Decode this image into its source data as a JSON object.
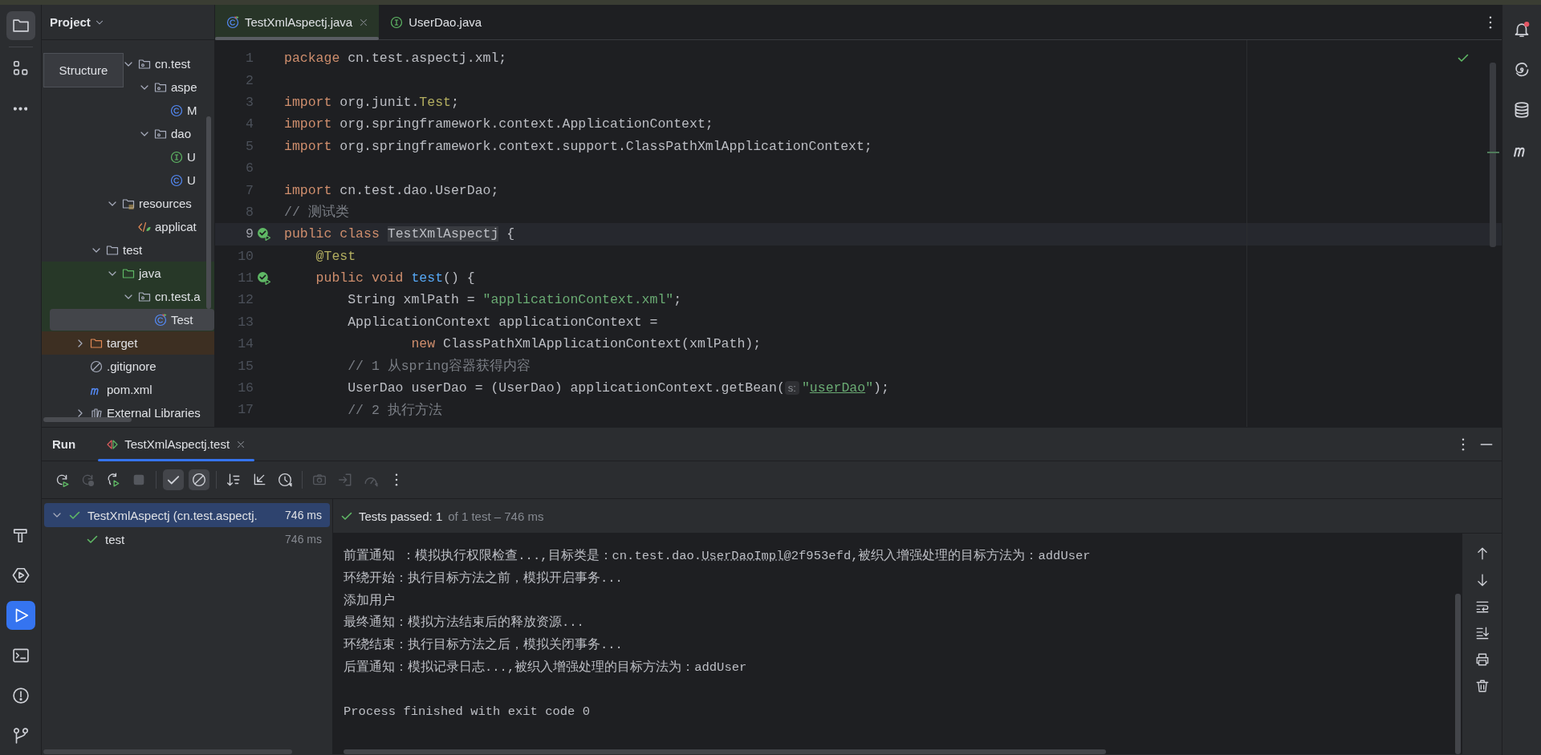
{
  "tool_strip": {
    "top": [
      {
        "selected": true
      },
      {
        "selected": false
      }
    ],
    "bottom": [
      {
        "selected": false
      },
      {
        "selected": false
      },
      {
        "selected": true
      },
      {
        "selected": false
      },
      {
        "selected": false
      },
      {
        "selected": false
      }
    ]
  },
  "project_panel": {
    "title": "Project",
    "tooltip": "Structure",
    "tree": [
      {
        "continued": true,
        "children": [
          {
            "continued": true,
            "children": [
              {
                "continued": true,
                "children": [
                  {
                    "label": "cn.test",
                    "kind": "package",
                    "expanded": true,
                    "selected": false,
                    "children": [
                      {
                        "label": "aspe",
                        "kind": "package",
                        "expanded": true,
                        "selected": false,
                        "children": [
                          {
                            "label": "M",
                            "kind": "class",
                            "selected": false
                          }
                        ]
                      },
                      {
                        "label": "dao",
                        "kind": "package",
                        "expanded": true,
                        "selected": false,
                        "children": [
                          {
                            "label": "U",
                            "kind": "interface",
                            "selected": false
                          },
                          {
                            "label": "U",
                            "kind": "class",
                            "selected": false
                          }
                        ]
                      }
                    ]
                  }
                ]
              },
              {
                "label": "resources",
                "kind": "resources",
                "expanded": true,
                "selected": false,
                "children": [
                  {
                    "label": "applicat",
                    "kind": "xml",
                    "selected": false
                  }
                ]
              }
            ]
          },
          {
            "label": "test",
            "kind": "folder",
            "expanded": true,
            "selected": false,
            "children": [
              {
                "label": "java",
                "kind": "test-root",
                "expanded": true,
                "selected": false,
                "children": [
                  {
                    "label": "cn.test.a",
                    "kind": "package",
                    "expanded": true,
                    "selected": false,
                    "children": [
                      {
                        "label": "Test",
                        "kind": "test-class",
                        "selected": true
                      }
                    ]
                  }
                ]
              }
            ]
          }
        ]
      },
      {
        "label": "target",
        "kind": "excluded",
        "expanded": false,
        "selected": false
      },
      {
        "label": ".gitignore",
        "kind": "ignore",
        "selected": false
      },
      {
        "label": "pom.xml",
        "kind": "maven",
        "selected": false
      },
      {
        "label": "External Libraries",
        "kind": "library",
        "expanded": false,
        "selected": false
      }
    ]
  },
  "editor": {
    "tabs": [
      {
        "label": "TestXmlAspectj.java",
        "kind": "test-class",
        "selected": true
      },
      {
        "label": "UserDao.java",
        "kind": "interface",
        "selected": false
      }
    ],
    "no_problems": true,
    "lines": [
      {
        "number": "1",
        "tokens": [
          {
            "kind": "keyword",
            "text": "package"
          },
          {
            "kind": "plain",
            "text": " cn.test.aspectj.xml;"
          }
        ]
      },
      {
        "number": "2"
      },
      {
        "number": "3",
        "tokens": [
          {
            "kind": "keyword",
            "text": "import"
          },
          {
            "kind": "plain",
            "text": " org.junit."
          },
          {
            "kind": "annotation",
            "text": "Test"
          },
          {
            "kind": "plain",
            "text": ";"
          }
        ]
      },
      {
        "number": "4",
        "tokens": [
          {
            "kind": "keyword",
            "text": "import"
          },
          {
            "kind": "plain",
            "text": " org.springframework.context.ApplicationContext;"
          }
        ]
      },
      {
        "number": "5",
        "tokens": [
          {
            "kind": "keyword",
            "text": "import"
          },
          {
            "kind": "plain",
            "text": " org.springframework.context.support.ClassPathXmlApplicationContext;"
          }
        ]
      },
      {
        "number": "6"
      },
      {
        "number": "7",
        "tokens": [
          {
            "kind": "keyword",
            "text": "import"
          },
          {
            "kind": "plain",
            "text": " cn.test.dao.UserDao;"
          }
        ]
      },
      {
        "number": "8",
        "tokens": [
          {
            "kind": "comment",
            "text": "// 测试类"
          }
        ]
      },
      {
        "number": "9",
        "current": true,
        "run_marker": true,
        "tokens": [
          {
            "kind": "keyword",
            "text": "public class "
          },
          {
            "kind": "highlight",
            "text": "TestXmlAspectj"
          },
          {
            "kind": "plain",
            "text": " {"
          }
        ]
      },
      {
        "number": "10",
        "tokens": [
          {
            "kind": "annotation",
            "text": "    @Test"
          }
        ]
      },
      {
        "number": "11",
        "run_marker": true,
        "tokens": [
          {
            "kind": "keyword",
            "text": "    public void "
          },
          {
            "kind": "method",
            "text": "test"
          },
          {
            "kind": "plain",
            "text": "() {"
          }
        ]
      },
      {
        "number": "12",
        "tokens": [
          {
            "kind": "plain",
            "text": "        String xmlPath = "
          },
          {
            "kind": "string",
            "text": "\"applicationContext.xml\""
          },
          {
            "kind": "plain",
            "text": ";"
          }
        ]
      },
      {
        "number": "13",
        "tokens": [
          {
            "kind": "plain",
            "text": "        ApplicationContext applicationContext ="
          }
        ]
      },
      {
        "number": "14",
        "tokens": [
          {
            "kind": "keyword",
            "text": "                new"
          },
          {
            "kind": "plain",
            "text": " ClassPathXmlApplicationContext(xmlPath);"
          }
        ]
      },
      {
        "number": "15",
        "tokens": [
          {
            "kind": "comment",
            "text": "        // 1 从spring容器获得内容"
          }
        ]
      },
      {
        "number": "16",
        "tokens": [
          {
            "kind": "plain",
            "text": "        UserDao userDao = (UserDao) applicationContext.getBean("
          },
          {
            "kind": "hint",
            "text": "s:"
          },
          {
            "kind": "string",
            "text": "\""
          },
          {
            "kind": "link",
            "text": "userDao"
          },
          {
            "kind": "string",
            "text": "\""
          },
          {
            "kind": "plain",
            "text": ");"
          }
        ]
      },
      {
        "number": "17",
        "tokens": [
          {
            "kind": "comment",
            "text": "        // 2 执行方法"
          }
        ]
      }
    ]
  },
  "right_strip": {
    "notification_badge": true
  },
  "run_panel": {
    "title": "Run",
    "tabs": [
      {
        "label": "TestXmlAspectj.test",
        "selected": true
      }
    ],
    "toolbar": [
      {
        "on": false,
        "disabled": false
      },
      {
        "on": false,
        "disabled": true
      },
      {
        "on": false,
        "disabled": false
      },
      {
        "on": false,
        "disabled": true
      },
      {
        "on": true,
        "disabled": false
      },
      {
        "on": true,
        "disabled": false
      },
      {
        "on": false,
        "disabled": false
      },
      {
        "on": false,
        "disabled": false
      },
      {
        "on": false,
        "disabled": false
      },
      {
        "on": false,
        "disabled": true
      },
      {
        "on": false,
        "disabled": true
      },
      {
        "on": false,
        "disabled": true
      }
    ],
    "tests": [
      {
        "label": "TestXmlAspectj (cn.test.aspectj.",
        "time": "746 ms",
        "passed": true,
        "expanded": true,
        "selected": true,
        "children": [
          {
            "label": "test",
            "time": "746 ms",
            "passed": true,
            "selected": false
          }
        ]
      }
    ],
    "summary": {
      "passed": true,
      "label": "Tests passed:",
      "count": "1",
      "detail": "of 1 test – 746 ms"
    },
    "console": [
      {
        "parts": [
          {
            "kind": "text",
            "text": "前置通知 ：模拟执行权限检查...,目标类是：cn.test.dao."
          },
          {
            "kind": "link",
            "text": "UserDaoImpl"
          },
          {
            "kind": "text",
            "text": "@2f953efd,被织入增强处理的目标方法为：addUser"
          }
        ]
      },
      {
        "parts": [
          {
            "kind": "text",
            "text": "环绕开始：执行目标方法之前，模拟开启事务..."
          }
        ]
      },
      {
        "parts": [
          {
            "kind": "text",
            "text": "添加用户"
          }
        ]
      },
      {
        "parts": [
          {
            "kind": "text",
            "text": "最终通知：模拟方法结束后的释放资源..."
          }
        ]
      },
      {
        "parts": [
          {
            "kind": "text",
            "text": "环绕结束：执行目标方法之后，模拟关闭事务..."
          }
        ]
      },
      {
        "parts": [
          {
            "kind": "text",
            "text": "后置通知：模拟记录日志...,被织入增强处理的目标方法为：addUser"
          }
        ]
      },
      {
        "gap_before": true,
        "parts": [
          {
            "kind": "text",
            "text": "Process finished with exit code 0"
          }
        ]
      }
    ]
  }
}
